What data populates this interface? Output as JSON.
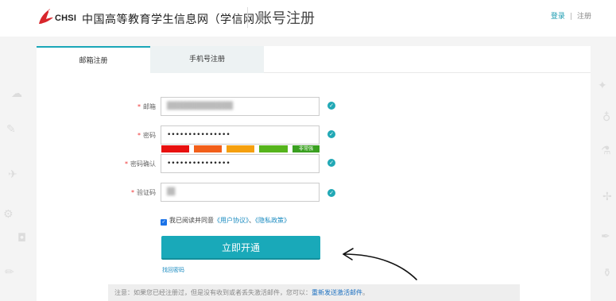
{
  "header": {
    "logo_text": "CHSI",
    "site_name": "中国高等教育学生信息网（学信网）",
    "page_title": "账号注册",
    "login_link": "登录",
    "separator": "|",
    "register_link": "注册"
  },
  "tabs": [
    {
      "label": "邮箱注册",
      "active": true
    },
    {
      "label": "手机号注册",
      "active": false
    }
  ],
  "form": {
    "required_mark": "*",
    "email": {
      "label": "邮箱",
      "value": "████████████"
    },
    "password": {
      "label": "密码",
      "value": "•••••••••••••••"
    },
    "strength": {
      "colors": [
        "#e8100f",
        "#f25f1a",
        "#f5a00f",
        "#56b41c",
        "#3aa020"
      ],
      "label": "非常强",
      "level": 5
    },
    "confirm": {
      "label": "密码确认",
      "value": "•••••••••••••••"
    },
    "captcha": {
      "label": "验证码",
      "value": "█▌"
    },
    "agree": {
      "checked": true,
      "text": "我已阅读并同意",
      "link1": "《用户协议》",
      "middle": "、",
      "link2": "《隐私政策》"
    },
    "submit": "立即开通",
    "forgot": "找回密码"
  },
  "notice": {
    "text": "注意：如果您已经注册过，但是没有收到或者丢失激活邮件，您可以：",
    "link": "重新发送激活邮件",
    "tail": "。"
  },
  "colors": {
    "accent": "#19a9b9",
    "link": "#1a8bc0",
    "required": "#e33333"
  }
}
